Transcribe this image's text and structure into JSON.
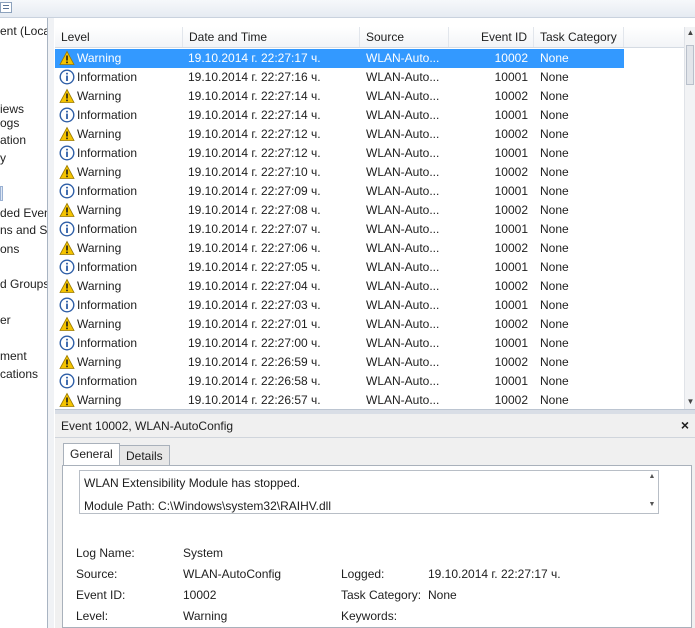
{
  "tree": {
    "items": [
      "ent (Local",
      "",
      "iews",
      "ogs",
      "ation",
      "y",
      "",
      "ded Event",
      "ns and Se",
      "ons",
      "d Groups",
      "er",
      "ment",
      "cations"
    ]
  },
  "grid": {
    "columns": [
      "Level",
      "Date and Time",
      "Source",
      "Event ID",
      "Task Category"
    ],
    "rows": [
      {
        "icon": "warning-icon",
        "level": "Warning",
        "date": "19.10.2014 г. 22:27:17 ч.",
        "source": "WLAN-Auto...",
        "id": "10002",
        "cat": "None",
        "selected": true
      },
      {
        "icon": "information-icon",
        "level": "Information",
        "date": "19.10.2014 г. 22:27:16 ч.",
        "source": "WLAN-Auto...",
        "id": "10001",
        "cat": "None"
      },
      {
        "icon": "warning-icon",
        "level": "Warning",
        "date": "19.10.2014 г. 22:27:14 ч.",
        "source": "WLAN-Auto...",
        "id": "10002",
        "cat": "None"
      },
      {
        "icon": "information-icon",
        "level": "Information",
        "date": "19.10.2014 г. 22:27:14 ч.",
        "source": "WLAN-Auto...",
        "id": "10001",
        "cat": "None"
      },
      {
        "icon": "warning-icon",
        "level": "Warning",
        "date": "19.10.2014 г. 22:27:12 ч.",
        "source": "WLAN-Auto...",
        "id": "10002",
        "cat": "None"
      },
      {
        "icon": "information-icon",
        "level": "Information",
        "date": "19.10.2014 г. 22:27:12 ч.",
        "source": "WLAN-Auto...",
        "id": "10001",
        "cat": "None"
      },
      {
        "icon": "warning-icon",
        "level": "Warning",
        "date": "19.10.2014 г. 22:27:10 ч.",
        "source": "WLAN-Auto...",
        "id": "10002",
        "cat": "None"
      },
      {
        "icon": "information-icon",
        "level": "Information",
        "date": "19.10.2014 г. 22:27:09 ч.",
        "source": "WLAN-Auto...",
        "id": "10001",
        "cat": "None"
      },
      {
        "icon": "warning-icon",
        "level": "Warning",
        "date": "19.10.2014 г. 22:27:08 ч.",
        "source": "WLAN-Auto...",
        "id": "10002",
        "cat": "None"
      },
      {
        "icon": "information-icon",
        "level": "Information",
        "date": "19.10.2014 г. 22:27:07 ч.",
        "source": "WLAN-Auto...",
        "id": "10001",
        "cat": "None"
      },
      {
        "icon": "warning-icon",
        "level": "Warning",
        "date": "19.10.2014 г. 22:27:06 ч.",
        "source": "WLAN-Auto...",
        "id": "10002",
        "cat": "None"
      },
      {
        "icon": "information-icon",
        "level": "Information",
        "date": "19.10.2014 г. 22:27:05 ч.",
        "source": "WLAN-Auto...",
        "id": "10001",
        "cat": "None"
      },
      {
        "icon": "warning-icon",
        "level": "Warning",
        "date": "19.10.2014 г. 22:27:04 ч.",
        "source": "WLAN-Auto...",
        "id": "10002",
        "cat": "None"
      },
      {
        "icon": "information-icon",
        "level": "Information",
        "date": "19.10.2014 г. 22:27:03 ч.",
        "source": "WLAN-Auto...",
        "id": "10001",
        "cat": "None"
      },
      {
        "icon": "warning-icon",
        "level": "Warning",
        "date": "19.10.2014 г. 22:27:01 ч.",
        "source": "WLAN-Auto...",
        "id": "10002",
        "cat": "None"
      },
      {
        "icon": "information-icon",
        "level": "Information",
        "date": "19.10.2014 г. 22:27:00 ч.",
        "source": "WLAN-Auto...",
        "id": "10001",
        "cat": "None"
      },
      {
        "icon": "warning-icon",
        "level": "Warning",
        "date": "19.10.2014 г. 22:26:59 ч.",
        "source": "WLAN-Auto...",
        "id": "10002",
        "cat": "None"
      },
      {
        "icon": "information-icon",
        "level": "Information",
        "date": "19.10.2014 г. 22:26:58 ч.",
        "source": "WLAN-Auto...",
        "id": "10001",
        "cat": "None"
      },
      {
        "icon": "warning-icon",
        "level": "Warning",
        "date": "19.10.2014 г. 22:26:57 ч.",
        "source": "WLAN-Auto...",
        "id": "10002",
        "cat": "None"
      }
    ]
  },
  "detail": {
    "title": "Event 10002, WLAN-AutoConfig",
    "close": "×",
    "tabs": [
      "General",
      "Details"
    ],
    "description_line1": "WLAN Extensibility Module has stopped.",
    "description_line2": "Module Path: C:\\Windows\\system32\\RAIHV.dll",
    "fields": {
      "log_name_label": "Log Name:",
      "log_name": "System",
      "source_label": "Source:",
      "source": "WLAN-AutoConfig",
      "logged_label": "Logged:",
      "logged": "19.10.2014 г. 22:27:17 ч.",
      "event_id_label": "Event ID:",
      "event_id": "10002",
      "task_label": "Task Category:",
      "task": "None",
      "level_label": "Level:",
      "level": "Warning",
      "keywords_label": "Keywords:"
    }
  },
  "colors": {
    "selection": "#3399ff",
    "warning": "#f5c400",
    "info": "#2f5fa7"
  }
}
